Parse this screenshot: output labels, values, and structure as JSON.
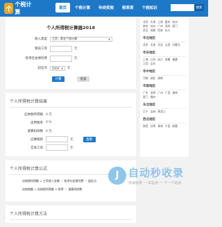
{
  "header": {
    "logo_mark": "个",
    "logo_text": "个税计算",
    "nav": [
      {
        "label": "首页",
        "active": true
      },
      {
        "label": "个税计算",
        "active": false
      },
      {
        "label": "年终奖税",
        "active": false
      },
      {
        "label": "税率表",
        "active": false
      },
      {
        "label": "个税知识",
        "active": false
      }
    ],
    "search_button": "搜索"
  },
  "calculator": {
    "title": "个人所得税计算器2018",
    "fields": {
      "income_type_label": "收入类型",
      "income_type_value": "工资、薪金个税计算",
      "pretax_label": "税前工资",
      "insurance_label": "各项社会保险费",
      "threshold_label": "起征点",
      "threshold_value": "5000",
      "unit": "元"
    },
    "buttons": {
      "calculate": "计算",
      "reset": "重置"
    }
  },
  "results": {
    "section_title": "个人所得税计算结果",
    "rows": [
      {
        "label": "应纳税所得额",
        "value": "0 元"
      },
      {
        "label": "适用税率",
        "value": "0 %"
      },
      {
        "label": "速算扣除数",
        "value": "0 元"
      },
      {
        "label": "应缴税款",
        "value": "0 元"
      },
      {
        "label": "实发工资",
        "value": "0 元"
      }
    ],
    "detail_button": "查看"
  },
  "formula": {
    "section_title": "个人所得税计算公式",
    "items": [
      "应纳税所得额 = 工资收入金额 － 各项社会保险费 － 起征点",
      "应纳税额 = 应纳税所得额 × 税率 － 速算扣除数"
    ]
  },
  "method": {
    "section_title": "个人所得税计算方法"
  },
  "sidebar": {
    "blocks": [
      {
        "title": "",
        "cities": [
          "北京",
          "天津",
          "上海",
          "重庆",
          "杭州",
          "南京",
          "苏州",
          "广州",
          "深圳",
          "厦门",
          "武汉",
          "成都",
          "西安",
          "长沙"
        ]
      },
      {
        "title": "华北地区",
        "cities": [
          "北京",
          "天津",
          "河北",
          "山西",
          "内蒙古"
        ]
      },
      {
        "title": "华东地区",
        "cities": [
          "上海",
          "江苏",
          "浙江",
          "安徽",
          "福建",
          "江西",
          "山东"
        ]
      },
      {
        "title": "华中地区",
        "cities": [
          "河南",
          "湖北",
          "湖南"
        ]
      },
      {
        "title": "华南地区",
        "cities": [
          "广东",
          "深圳",
          "广州",
          "广西",
          "海南",
          "厦门",
          "福州"
        ]
      },
      {
        "title": "东北地区",
        "cities": [
          "辽宁",
          "吉林",
          "黑龙江"
        ]
      },
      {
        "title": "西北地区",
        "cities": [
          "陕西",
          "甘肃",
          "青海",
          "宁夏",
          "新疆"
        ]
      }
    ]
  },
  "watermark": {
    "mark": "J",
    "title": "自动秒收录",
    "subtitle": "快速收录 一 本站点 一 下一个站点"
  }
}
